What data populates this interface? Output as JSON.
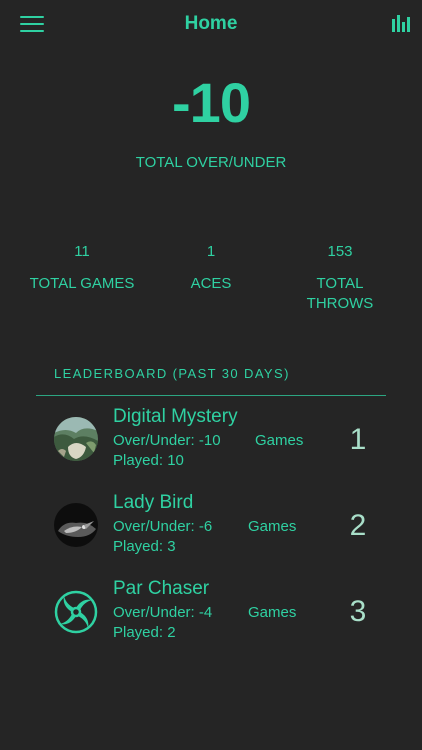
{
  "nav": {
    "title": "Home",
    "menu_icon": "hamburger-menu-icon",
    "stats_icon": "bar-chart-icon"
  },
  "summary": {
    "over_under_value": "-10",
    "over_under_label": "TOTAL OVER/UNDER"
  },
  "stats": [
    {
      "value": "11",
      "label": "TOTAL GAMES"
    },
    {
      "value": "1",
      "label": "ACES"
    },
    {
      "value": "153",
      "label": "TOTAL THROWS"
    }
  ],
  "leaderboard": {
    "title": "LEADERBOARD (PAST 30 DAYS)",
    "entries": [
      {
        "name": "Digital Mystery",
        "over_under": "Over/Under: -10",
        "games_label": "Games",
        "played": "Played: 10",
        "rank": "1"
      },
      {
        "name": "Lady Bird",
        "over_under": "Over/Under: -6",
        "games_label": "Games",
        "played": "Played: 3",
        "rank": "2"
      },
      {
        "name": "Par Chaser",
        "over_under": "Over/Under: -4",
        "games_label": "Games",
        "played": "Played: 2",
        "rank": "3"
      }
    ]
  },
  "colors": {
    "background": "#252525",
    "accent": "#2fd1a2",
    "rank": "#a9dfc9"
  }
}
